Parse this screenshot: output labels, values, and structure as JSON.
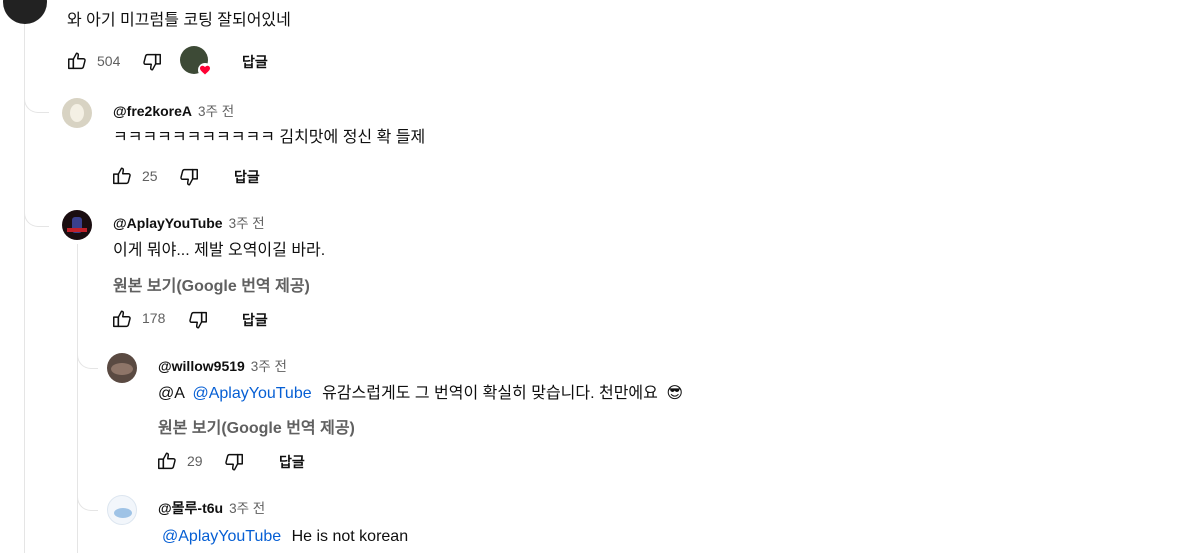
{
  "top_comment": {
    "text": "와 아기 미끄럼틀 코팅 잘되어있네",
    "likes": "504",
    "reply_label": "답글"
  },
  "replies": [
    {
      "handle": "@fre2koreA",
      "time": "3주 전",
      "text": "ㅋㅋㅋㅋㅋㅋㅋㅋㅋㅋㅋ 김치맛에 정신 확 들제",
      "likes": "25",
      "reply_label": "답글"
    },
    {
      "handle": "@AplayYouTube",
      "time": "3주 전",
      "text": "이게 뭐야... 제발 오역이길 바라.",
      "translate": "원본 보기(Google 번역 제공)",
      "likes": "178",
      "reply_label": "답글"
    },
    {
      "handle": "@willow9519",
      "time": "3주 전",
      "text_prefix": "@A",
      "mention": "@AplayYouTube",
      "text": "유감스럽게도 그 번역이 확실히 맞습니다. 천만에요",
      "emoji": "😎",
      "translate": "원본 보기(Google 번역 제공)",
      "likes": "29",
      "reply_label": "답글"
    },
    {
      "handle": "@몰루-t6u",
      "time": "3주 전",
      "mention": "@AplayYouTube",
      "text": "He is not korean"
    }
  ],
  "colors": {
    "mention": "#065fd4",
    "secondary_text": "#606060",
    "thread_line": "#e5e5e5",
    "heart": "#ff0033"
  }
}
